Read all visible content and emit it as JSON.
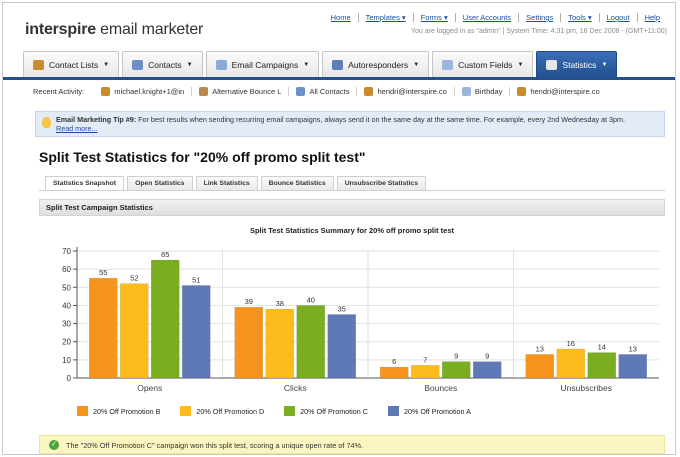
{
  "header": {
    "logo_part1": "interspire",
    "logo_part2": " email marketer",
    "links": [
      "Home",
      "Templates ▾",
      "Forms ▾",
      "User Accounts",
      "Settings",
      "Tools ▾",
      "Logout",
      "Help"
    ],
    "user_info": "You are logged in as \"admin\" | System Time: 4:31 pm, 16 Dec 2008 - (GMT+11:00)"
  },
  "tabs": [
    {
      "label": "Contact Lists",
      "icon": "contact-lists-icon",
      "color": "#c98b2e"
    },
    {
      "label": "Contacts",
      "icon": "contacts-icon",
      "color": "#6c8fc5"
    },
    {
      "label": "Email Campaigns",
      "icon": "email-campaigns-icon",
      "color": "#8aa9d6"
    },
    {
      "label": "Autoresponders",
      "icon": "autoresponders-icon",
      "color": "#5b7fb6"
    },
    {
      "label": "Custom Fields",
      "icon": "custom-fields-icon",
      "color": "#9bb5dd"
    },
    {
      "label": "Statistics",
      "icon": "statistics-icon",
      "color": "#e6e6e6"
    }
  ],
  "recent": {
    "label": "Recent Activity:",
    "items": [
      {
        "text": "michael.knight+1@in",
        "icon": "contact-icon"
      },
      {
        "text": "Alternative Bounce L",
        "icon": "list-icon"
      },
      {
        "text": "All Contacts",
        "icon": "contacts-icon"
      },
      {
        "text": "hendri@interspire.co",
        "icon": "contact-icon"
      },
      {
        "text": "Birthday",
        "icon": "field-icon"
      },
      {
        "text": "hendri@interspire.co",
        "icon": "contact-icon"
      }
    ]
  },
  "tip": {
    "title": "Email Marketing Tip #9:",
    "text": " For best results when sending recurring email campaigns, always send it on the same day at the same time. For example, every 2nd Wednesday at 3pm.",
    "more": "Read more..."
  },
  "page_title": "Split Test Statistics for \"20% off promo split test\"",
  "subtabs": [
    "Statistics Snapshot",
    "Open Statistics",
    "Link Statistics",
    "Bounce Statistics",
    "Unsubscribe Statistics"
  ],
  "section_title": "Split Test Campaign Statistics",
  "chart_data": {
    "type": "bar",
    "title": "Split Test Statistics Summary for 20% off promo split test",
    "categories": [
      "Opens",
      "Clicks",
      "Bounces",
      "Unsubscribes"
    ],
    "series": [
      {
        "name": "20% Off Promotion B",
        "color": "#f7941d",
        "values": [
          55,
          39,
          6,
          13
        ]
      },
      {
        "name": "20% Off Promotion D",
        "color": "#fdbb1c",
        "values": [
          52,
          38,
          7,
          16
        ]
      },
      {
        "name": "20% Off Promotion C",
        "color": "#7aad1f",
        "values": [
          65,
          40,
          9,
          14
        ]
      },
      {
        "name": "20% Off Promotion A",
        "color": "#5f79b6",
        "values": [
          51,
          35,
          9,
          13
        ]
      }
    ],
    "ylim": [
      0,
      70
    ],
    "yticks": [
      0,
      10,
      20,
      30,
      40,
      50,
      60,
      70
    ],
    "grid": true,
    "legend": "bottom"
  },
  "winner_text": "The \"20% Off Promotion C\" campaign won this split test, scoring a unique open rate of 74%."
}
